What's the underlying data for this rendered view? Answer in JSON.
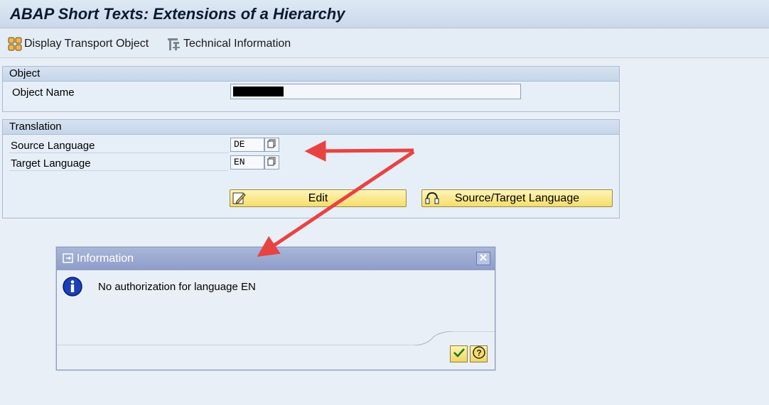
{
  "window": {
    "title": "ABAP Short Texts: Extensions of a Hierarchy"
  },
  "toolbar": {
    "display_transport": "Display Transport Object",
    "technical_info": "Technical Information"
  },
  "object_group": {
    "header": "Object",
    "object_name_label": "Object Name",
    "object_name_value": ""
  },
  "translation_group": {
    "header": "Translation",
    "source_label": "Source Language",
    "source_value": "DE",
    "target_label": "Target Language",
    "target_value": "EN",
    "edit_button": "Edit",
    "source_target_button": "Source/Target Language"
  },
  "dialog": {
    "title": "Information",
    "message": "No authorization for language EN"
  },
  "colors": {
    "accent_arrow": "#e84343",
    "button_yellow": "#f6dd6a",
    "dialog_title_bg": "#8e9dc9"
  }
}
